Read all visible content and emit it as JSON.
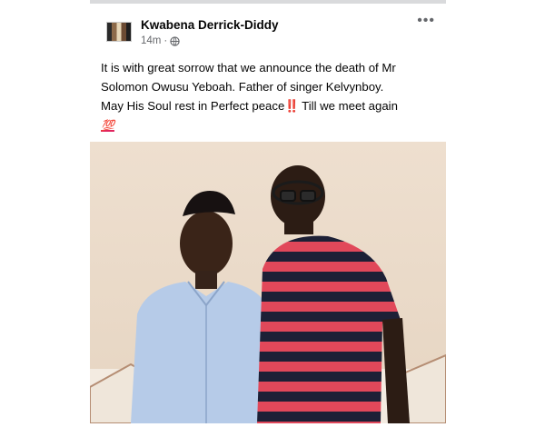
{
  "post": {
    "author": "Kwabena Derrick-Diddy",
    "time": "14m",
    "separator": "·",
    "more_label": "•••",
    "text_line1": "It is with great sorrow that we announce the death of Mr Solomon Owusu Yeboah. Father of singer Kelvynboy.",
    "text_line2_start": "May His Soul rest in Perfect peace",
    "text_line2_emoji": "‼️",
    "text_line2_end": " Till we meet again",
    "text_line3_emoji": "💯"
  },
  "icons": {
    "privacy": "globe-icon",
    "options": "more-options-icon"
  },
  "colors": {
    "secondary_text": "#65676b",
    "accent_red": "#e0245e"
  }
}
